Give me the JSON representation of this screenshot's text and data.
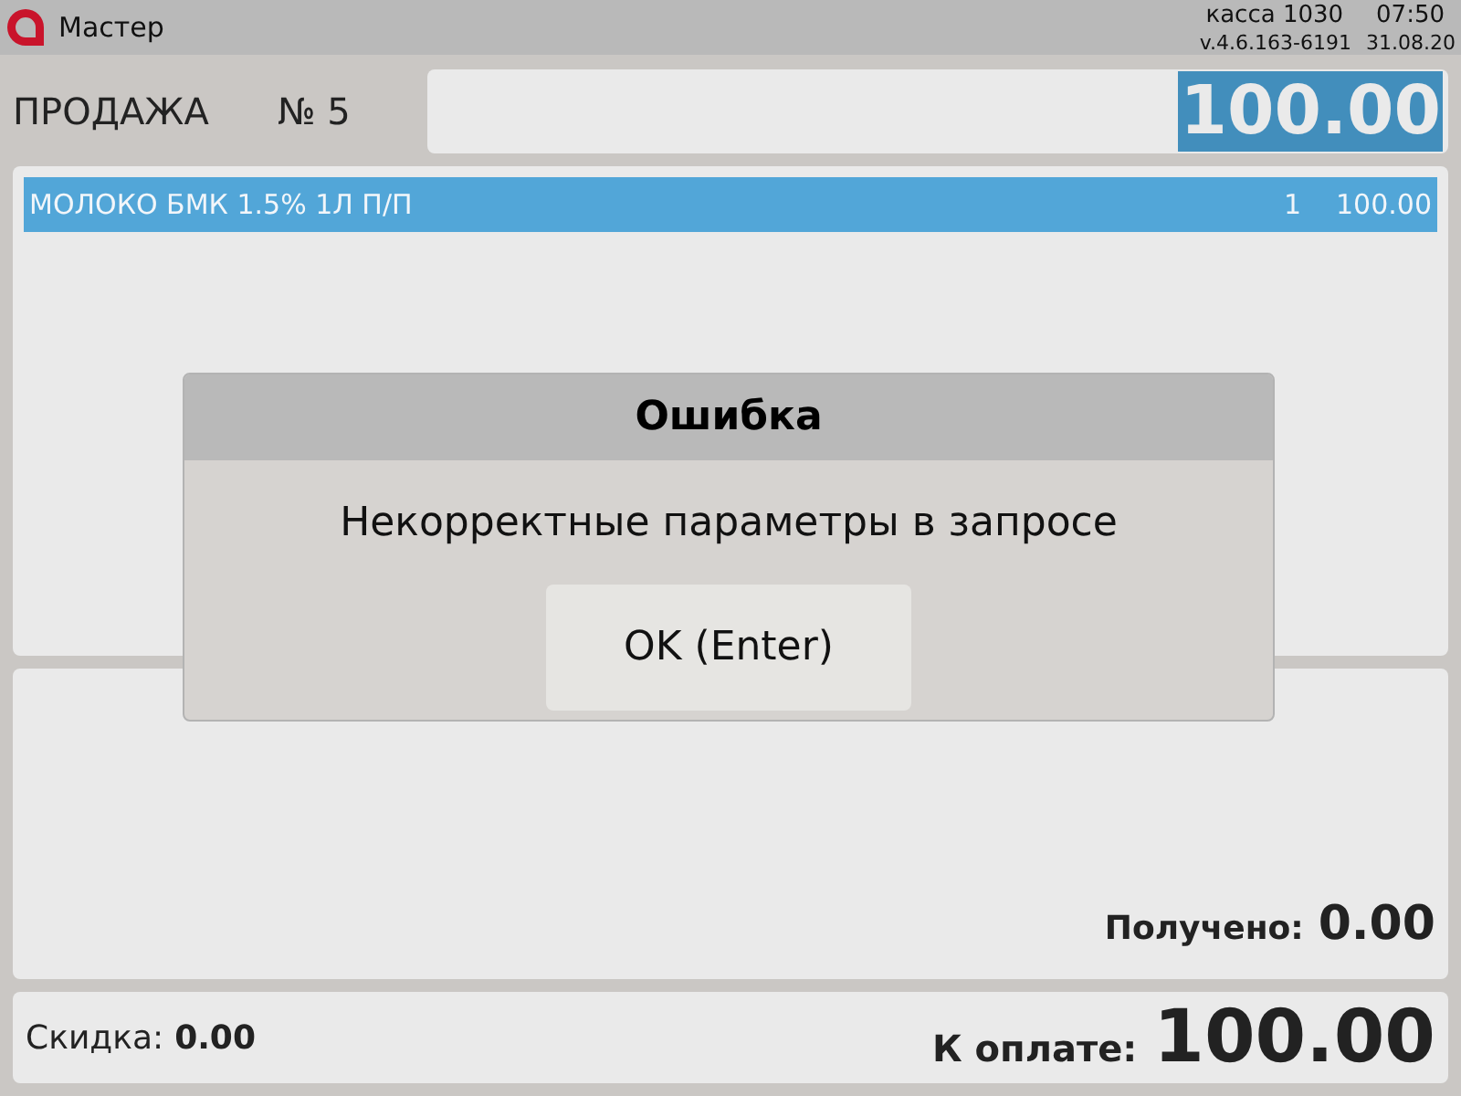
{
  "app": {
    "title": "Мастер"
  },
  "status": {
    "register": "касса 1030",
    "time": "07:50",
    "version": "v.4.6.163-6191",
    "date": "31.08.20"
  },
  "sale": {
    "title": "ПРОДАЖА",
    "number": "№ 5",
    "input": {
      "value": "100.00",
      "selected": true
    }
  },
  "items": [
    {
      "name": "МОЛОКО БМК 1.5% 1Л П/П",
      "quantity": "1",
      "sum": "100.00",
      "selected": true
    }
  ],
  "received": {
    "label": "Получено:",
    "value": "0.00"
  },
  "footer": {
    "discount_label": "Скидка:",
    "discount": "0.00",
    "total_label": "К оплате:",
    "total": "100.00"
  },
  "dialog": {
    "title": "Ошибка",
    "message": "Некорректные параметры в запросе",
    "button": "OK (Enter)"
  }
}
